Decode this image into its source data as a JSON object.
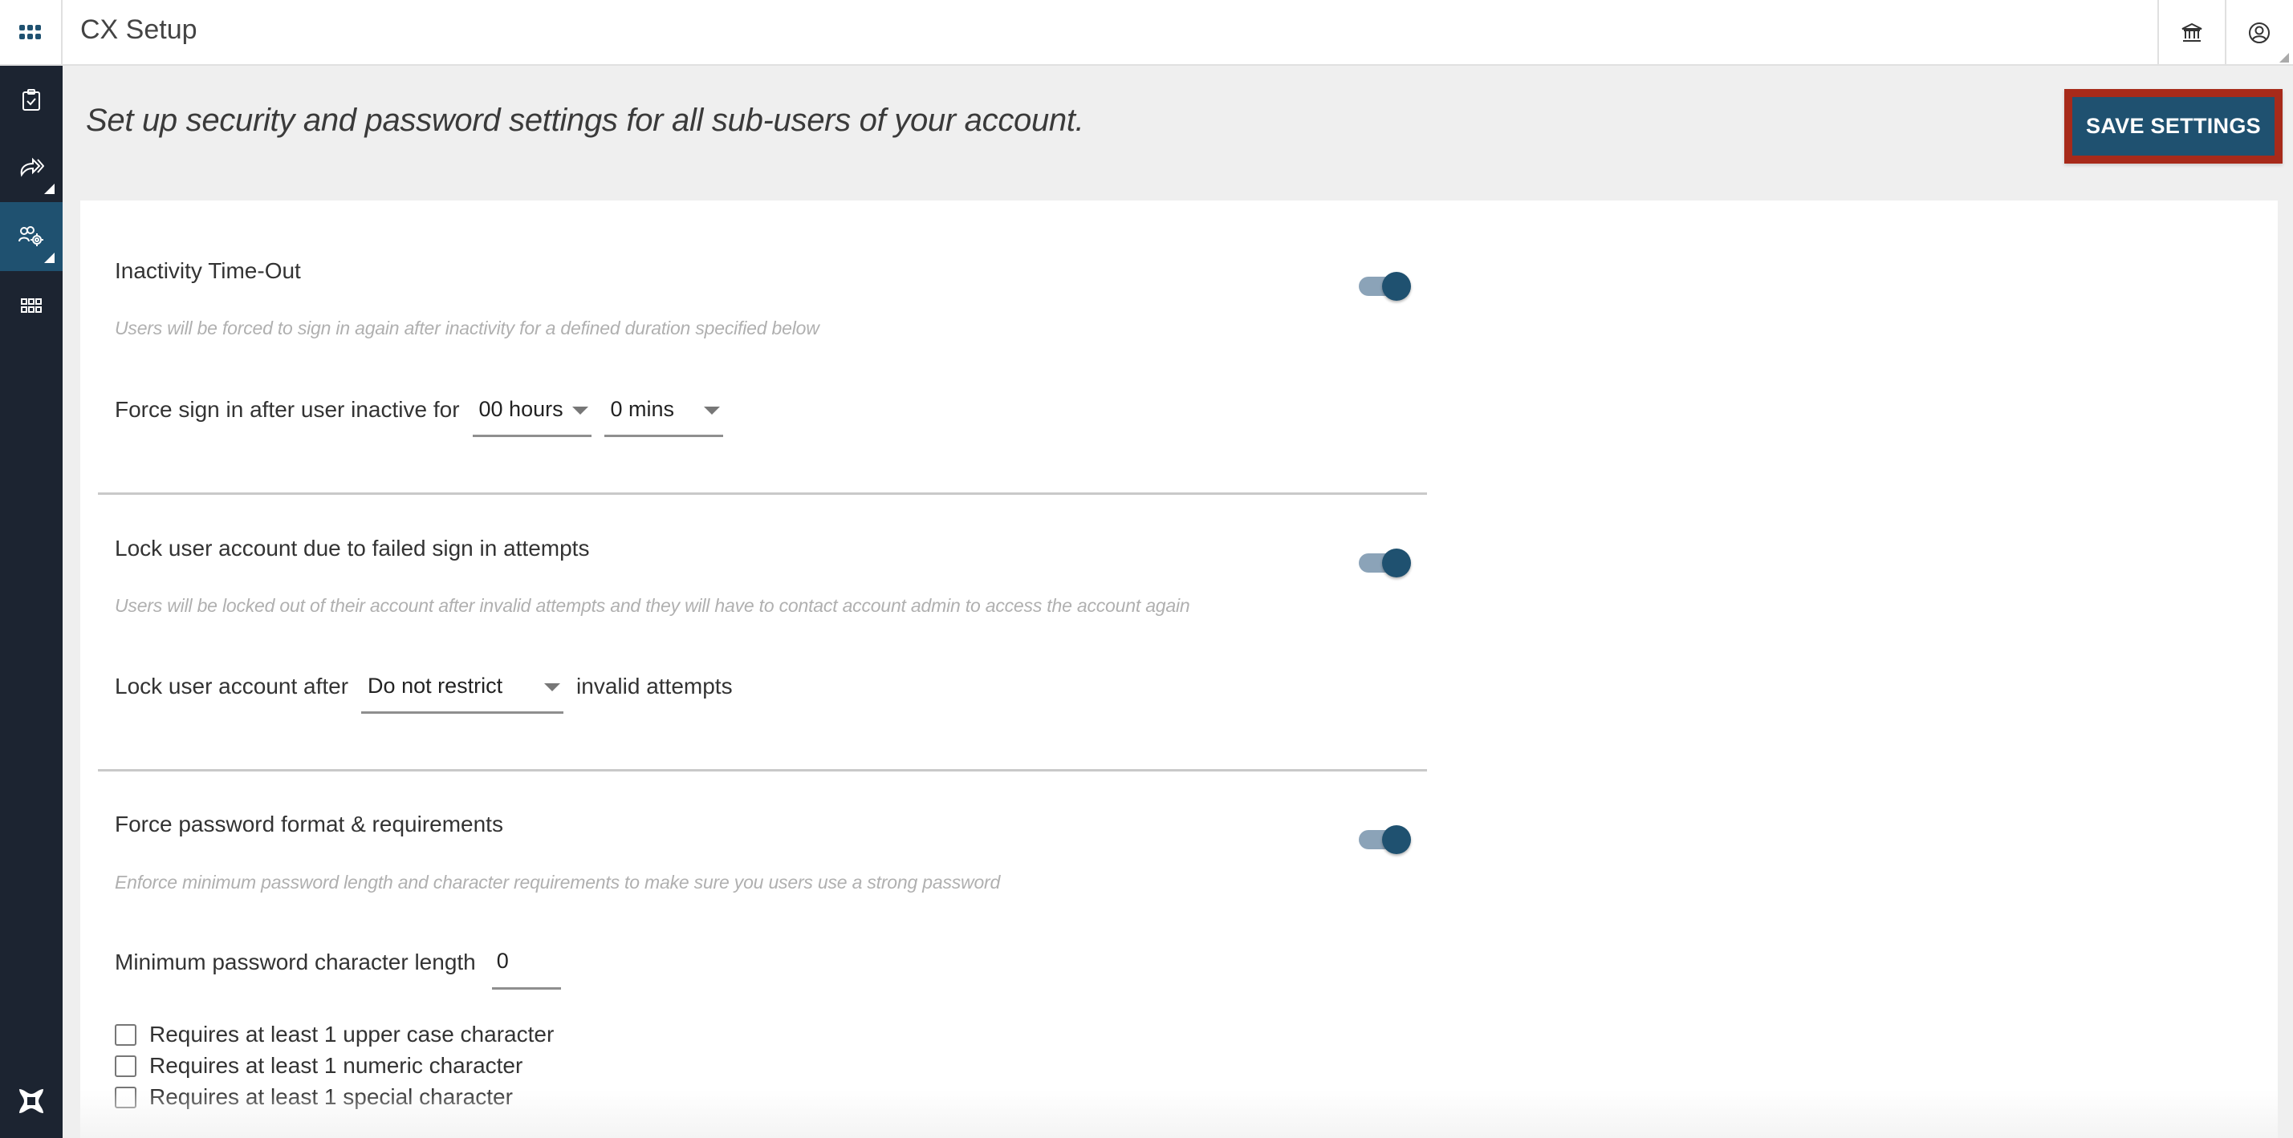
{
  "header": {
    "app_title": "CX Setup",
    "apps_icon": "grid-apps-icon",
    "right_icons": [
      "bank-building-icon",
      "user-account-icon"
    ]
  },
  "sidebar": {
    "items": [
      {
        "icon": "clipboard-check-icon",
        "active": false,
        "has_submenu": false
      },
      {
        "icon": "forward-share-icon",
        "active": false,
        "has_submenu": true
      },
      {
        "icon": "users-settings-icon",
        "active": true,
        "has_submenu": true
      },
      {
        "icon": "apps-grid-icon",
        "active": false,
        "has_submenu": false
      }
    ],
    "logo_icon": "brand-logo-icon"
  },
  "page": {
    "heading": "Set up security and password settings for all sub-users of your account.",
    "save_label": "SAVE SETTINGS"
  },
  "colors": {
    "primary": "#1f5170",
    "sidebar_bg": "#1c2431",
    "highlight_border": "#a72a1a",
    "toggle_track": "#8ba3b8"
  },
  "sections": {
    "inactivity": {
      "title": "Inactivity Time-Out",
      "enabled": true,
      "description": "Users will be forced to sign in again after inactivity for a defined duration specified below",
      "row_label": "Force sign in after user inactive for",
      "hours_value": "00 hours",
      "mins_value": "0 mins"
    },
    "lockout": {
      "title": "Lock user account due to failed sign in attempts",
      "enabled": true,
      "description": "Users will be locked out of their account after invalid attempts and they will have to contact account admin to access the account again",
      "row_label": "Lock user account after",
      "attempts_value": "Do not restrict",
      "after_label": "invalid attempts"
    },
    "password": {
      "title": "Force password format & requirements",
      "enabled": true,
      "description": "Enforce minimum password length and character requirements to make sure you users use a strong password",
      "min_length_label": "Minimum password character length",
      "min_length_value": "0",
      "requirements": [
        {
          "label": "Requires at least 1 upper case character",
          "checked": false
        },
        {
          "label": "Requires at least 1 numeric character",
          "checked": false
        },
        {
          "label": "Requires at least 1 special character",
          "checked": false
        }
      ]
    }
  }
}
